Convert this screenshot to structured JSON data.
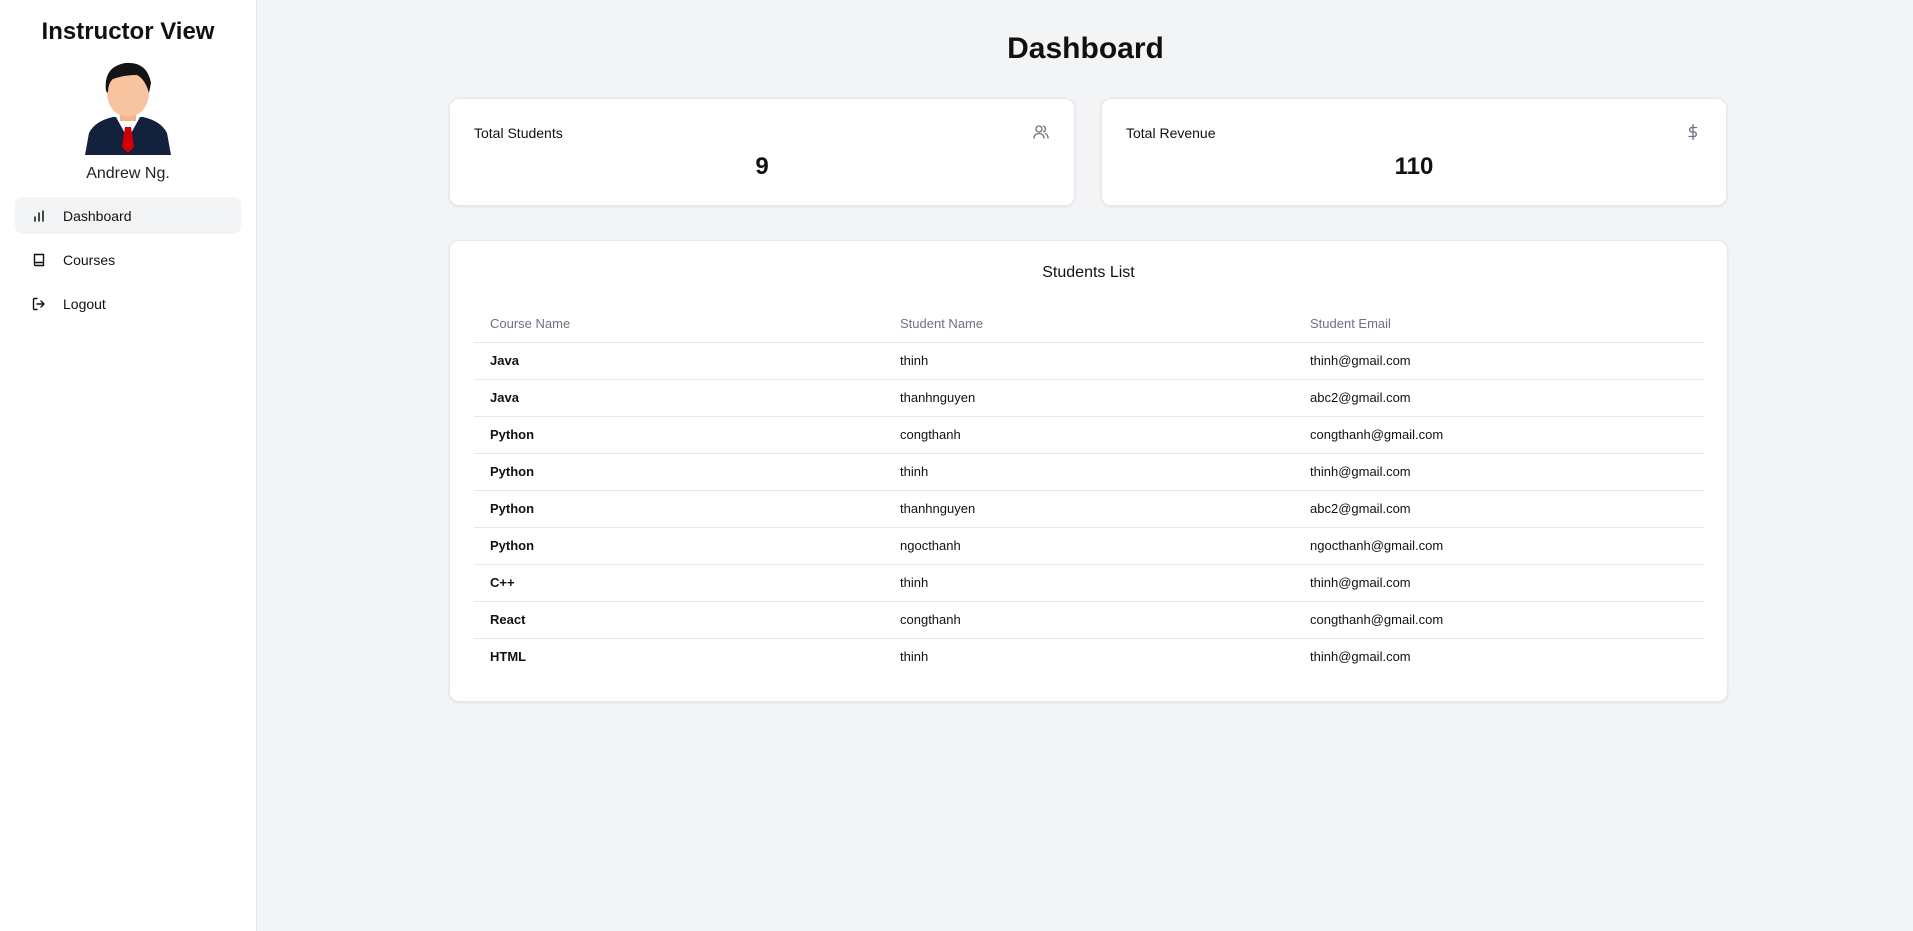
{
  "sidebar": {
    "title": "Instructor View",
    "user_name": "Andrew Ng.",
    "items": [
      {
        "label": "Dashboard",
        "icon": "bar-chart-icon",
        "active": true
      },
      {
        "label": "Courses",
        "icon": "book-icon",
        "active": false
      },
      {
        "label": "Logout",
        "icon": "logout-icon",
        "active": false
      }
    ]
  },
  "main": {
    "title": "Dashboard",
    "stats": [
      {
        "label": "Total Students",
        "value": "9",
        "icon": "users-icon"
      },
      {
        "label": "Total Revenue",
        "value": "110",
        "icon": "dollar-icon"
      }
    ],
    "students_list": {
      "title": "Students List",
      "columns": [
        "Course Name",
        "Student Name",
        "Student Email"
      ],
      "rows": [
        [
          "Java",
          "thinh",
          "thinh@gmail.com"
        ],
        [
          "Java",
          "thanhnguyen",
          "abc2@gmail.com"
        ],
        [
          "Python",
          "congthanh",
          "congthanh@gmail.com"
        ],
        [
          "Python",
          "thinh",
          "thinh@gmail.com"
        ],
        [
          "Python",
          "thanhnguyen",
          "abc2@gmail.com"
        ],
        [
          "Python",
          "ngocthanh",
          "ngocthanh@gmail.com"
        ],
        [
          "C++",
          "thinh",
          "thinh@gmail.com"
        ],
        [
          "React",
          "congthanh",
          "congthanh@gmail.com"
        ],
        [
          "HTML",
          "thinh",
          "thinh@gmail.com"
        ]
      ]
    }
  }
}
